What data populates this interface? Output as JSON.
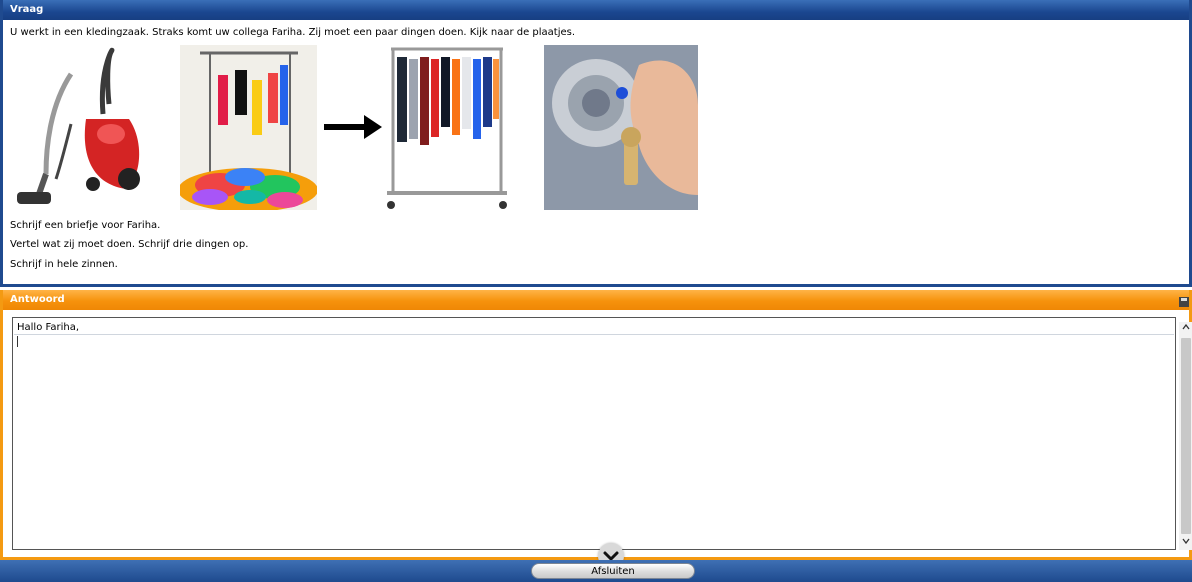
{
  "vraag": {
    "header": "Vraag",
    "intro": "U werkt in een kledingzaak. Straks komt uw collega Fariha. Zij moet een paar dingen doen. Kijk naar de plaatjes.",
    "instructions": [
      "Schrijf een briefje voor Fariha.",
      "Vertel wat zij moet doen. Schrijf drie dingen op.",
      "Schrijf in hele zinnen."
    ],
    "images": [
      "vacuum-cleaner",
      "messy-clothes-pile",
      "arrow-right",
      "tidy-clothing-rack",
      "key-in-lock"
    ]
  },
  "antwoord": {
    "header": "Antwoord",
    "answer_text": "Hallo Fariha,"
  },
  "footer": {
    "close_label": "Afsluiten"
  },
  "colors": {
    "blue": "#1f4a8f",
    "orange": "#f49a12"
  }
}
